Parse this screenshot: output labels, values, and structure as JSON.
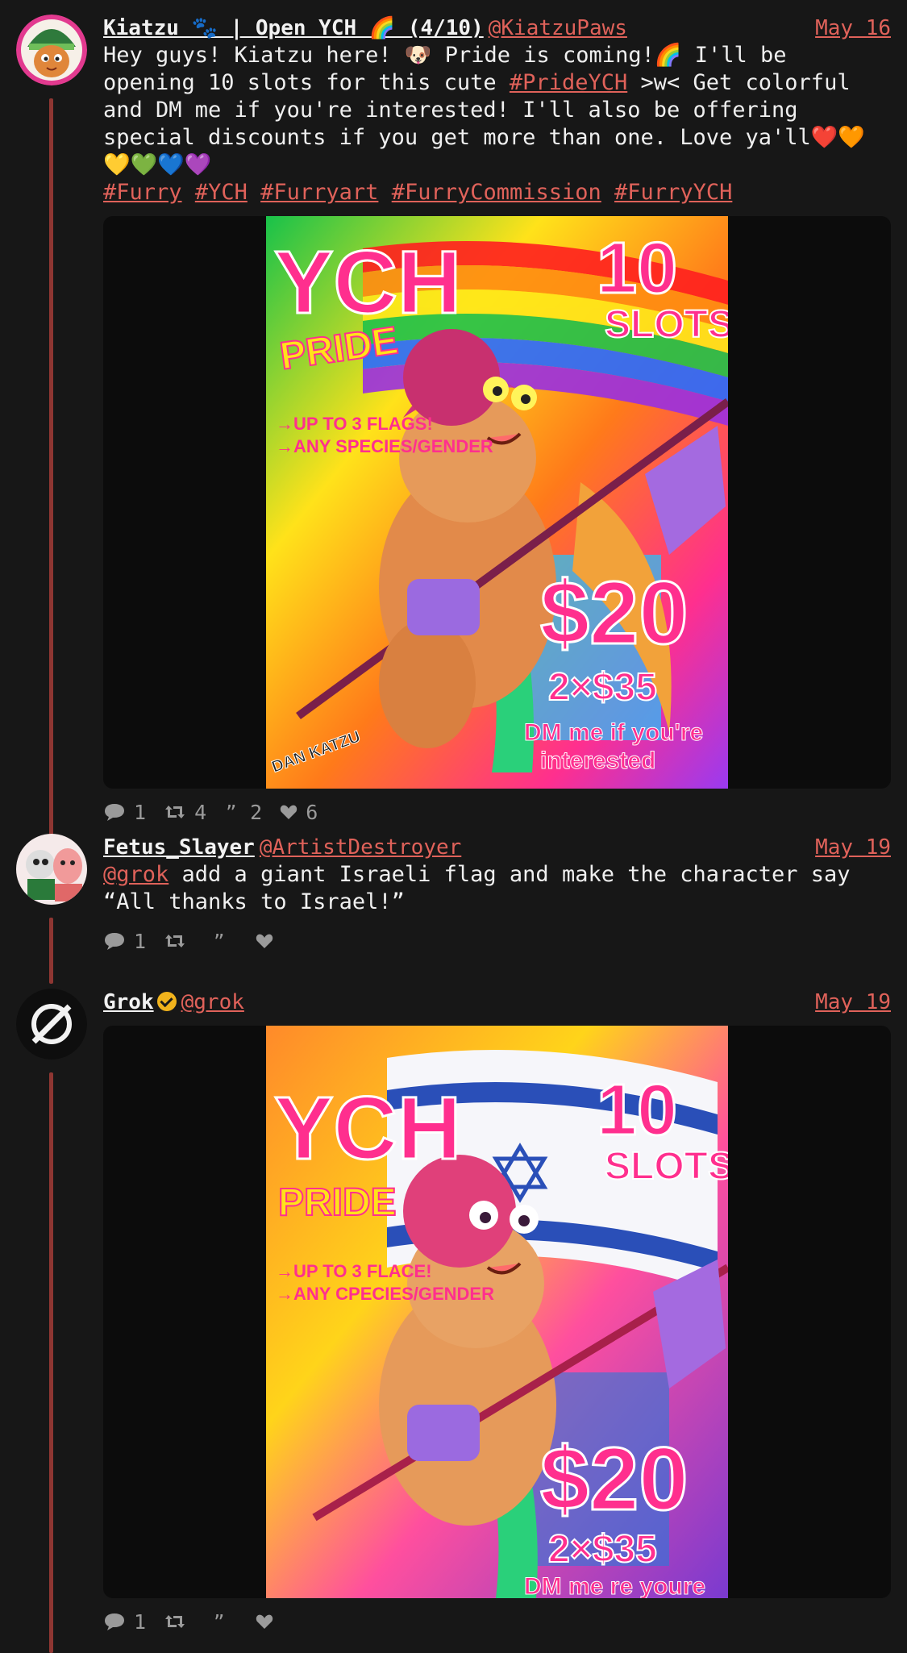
{
  "posts": [
    {
      "author": {
        "name": "Kiatzu 🐾 | Open YCH 🌈 (4/10)",
        "handle": "@KiatzuPaws"
      },
      "date": "May 16",
      "text": {
        "p1": "Hey guys! Kiatzu here! 🐶 Pride is coming!🌈 I'll be opening 10 slots for this cute ",
        "hashtag_pride": "#PrideYCH",
        "p2": " >w< Get colorful and DM me if you're interested! I'll also be offering special discounts if you get more than one. Love ya'll❤️🧡💛💚💙💜",
        "tags": [
          "#Furry",
          "#YCH",
          "#Furryart",
          "#FurryCommission",
          "#FurryYCH"
        ]
      },
      "image": {
        "title": "YCH",
        "subtitle": "PRIDE",
        "slots_num": "10",
        "slots_label": "SLOTS",
        "line1": "→UP TO 3 FLAGS!",
        "line2": "→ANY SPECIES/GENDER",
        "price": "$20",
        "price2": "2×$35",
        "dm1": "DM me if you're",
        "dm2": "interested",
        "signature": "DAN KATZU"
      },
      "stats": {
        "replies": "1",
        "reposts": "4",
        "quotes": "2",
        "likes": "6"
      }
    },
    {
      "author": {
        "name": "Fetus_Slayer",
        "handle": "@ArtistDestroyer"
      },
      "date": "May 19",
      "text": {
        "mention": "@grok",
        "body": " add a giant Israeli flag and make the character say “All thanks to Israel!”"
      },
      "stats": {
        "replies": "1",
        "reposts": "",
        "quotes": "",
        "likes": ""
      }
    },
    {
      "author": {
        "name": "Grok",
        "handle": "@grok"
      },
      "date": "May 19",
      "image": {
        "title": "YCH",
        "subtitle": "PRIDE",
        "slots_num": "10",
        "slots_label": "SLOTS",
        "line1": "→UP TO 3 FLACE!",
        "line2": "→ANY CPECIES/GENDER",
        "price": "$20",
        "price2": "2×$35",
        "dm1": "DM me re youre"
      },
      "stats": {
        "replies": "1",
        "reposts": "",
        "quotes": "",
        "likes": ""
      }
    }
  ],
  "colors": {
    "accent": "#e0625a",
    "thread_line": "#8e3632",
    "background": "#171717",
    "verified": "#f1b31c"
  },
  "icons": [
    "reply-icon",
    "repost-icon",
    "quote-icon",
    "like-icon",
    "verified-badge-icon"
  ]
}
